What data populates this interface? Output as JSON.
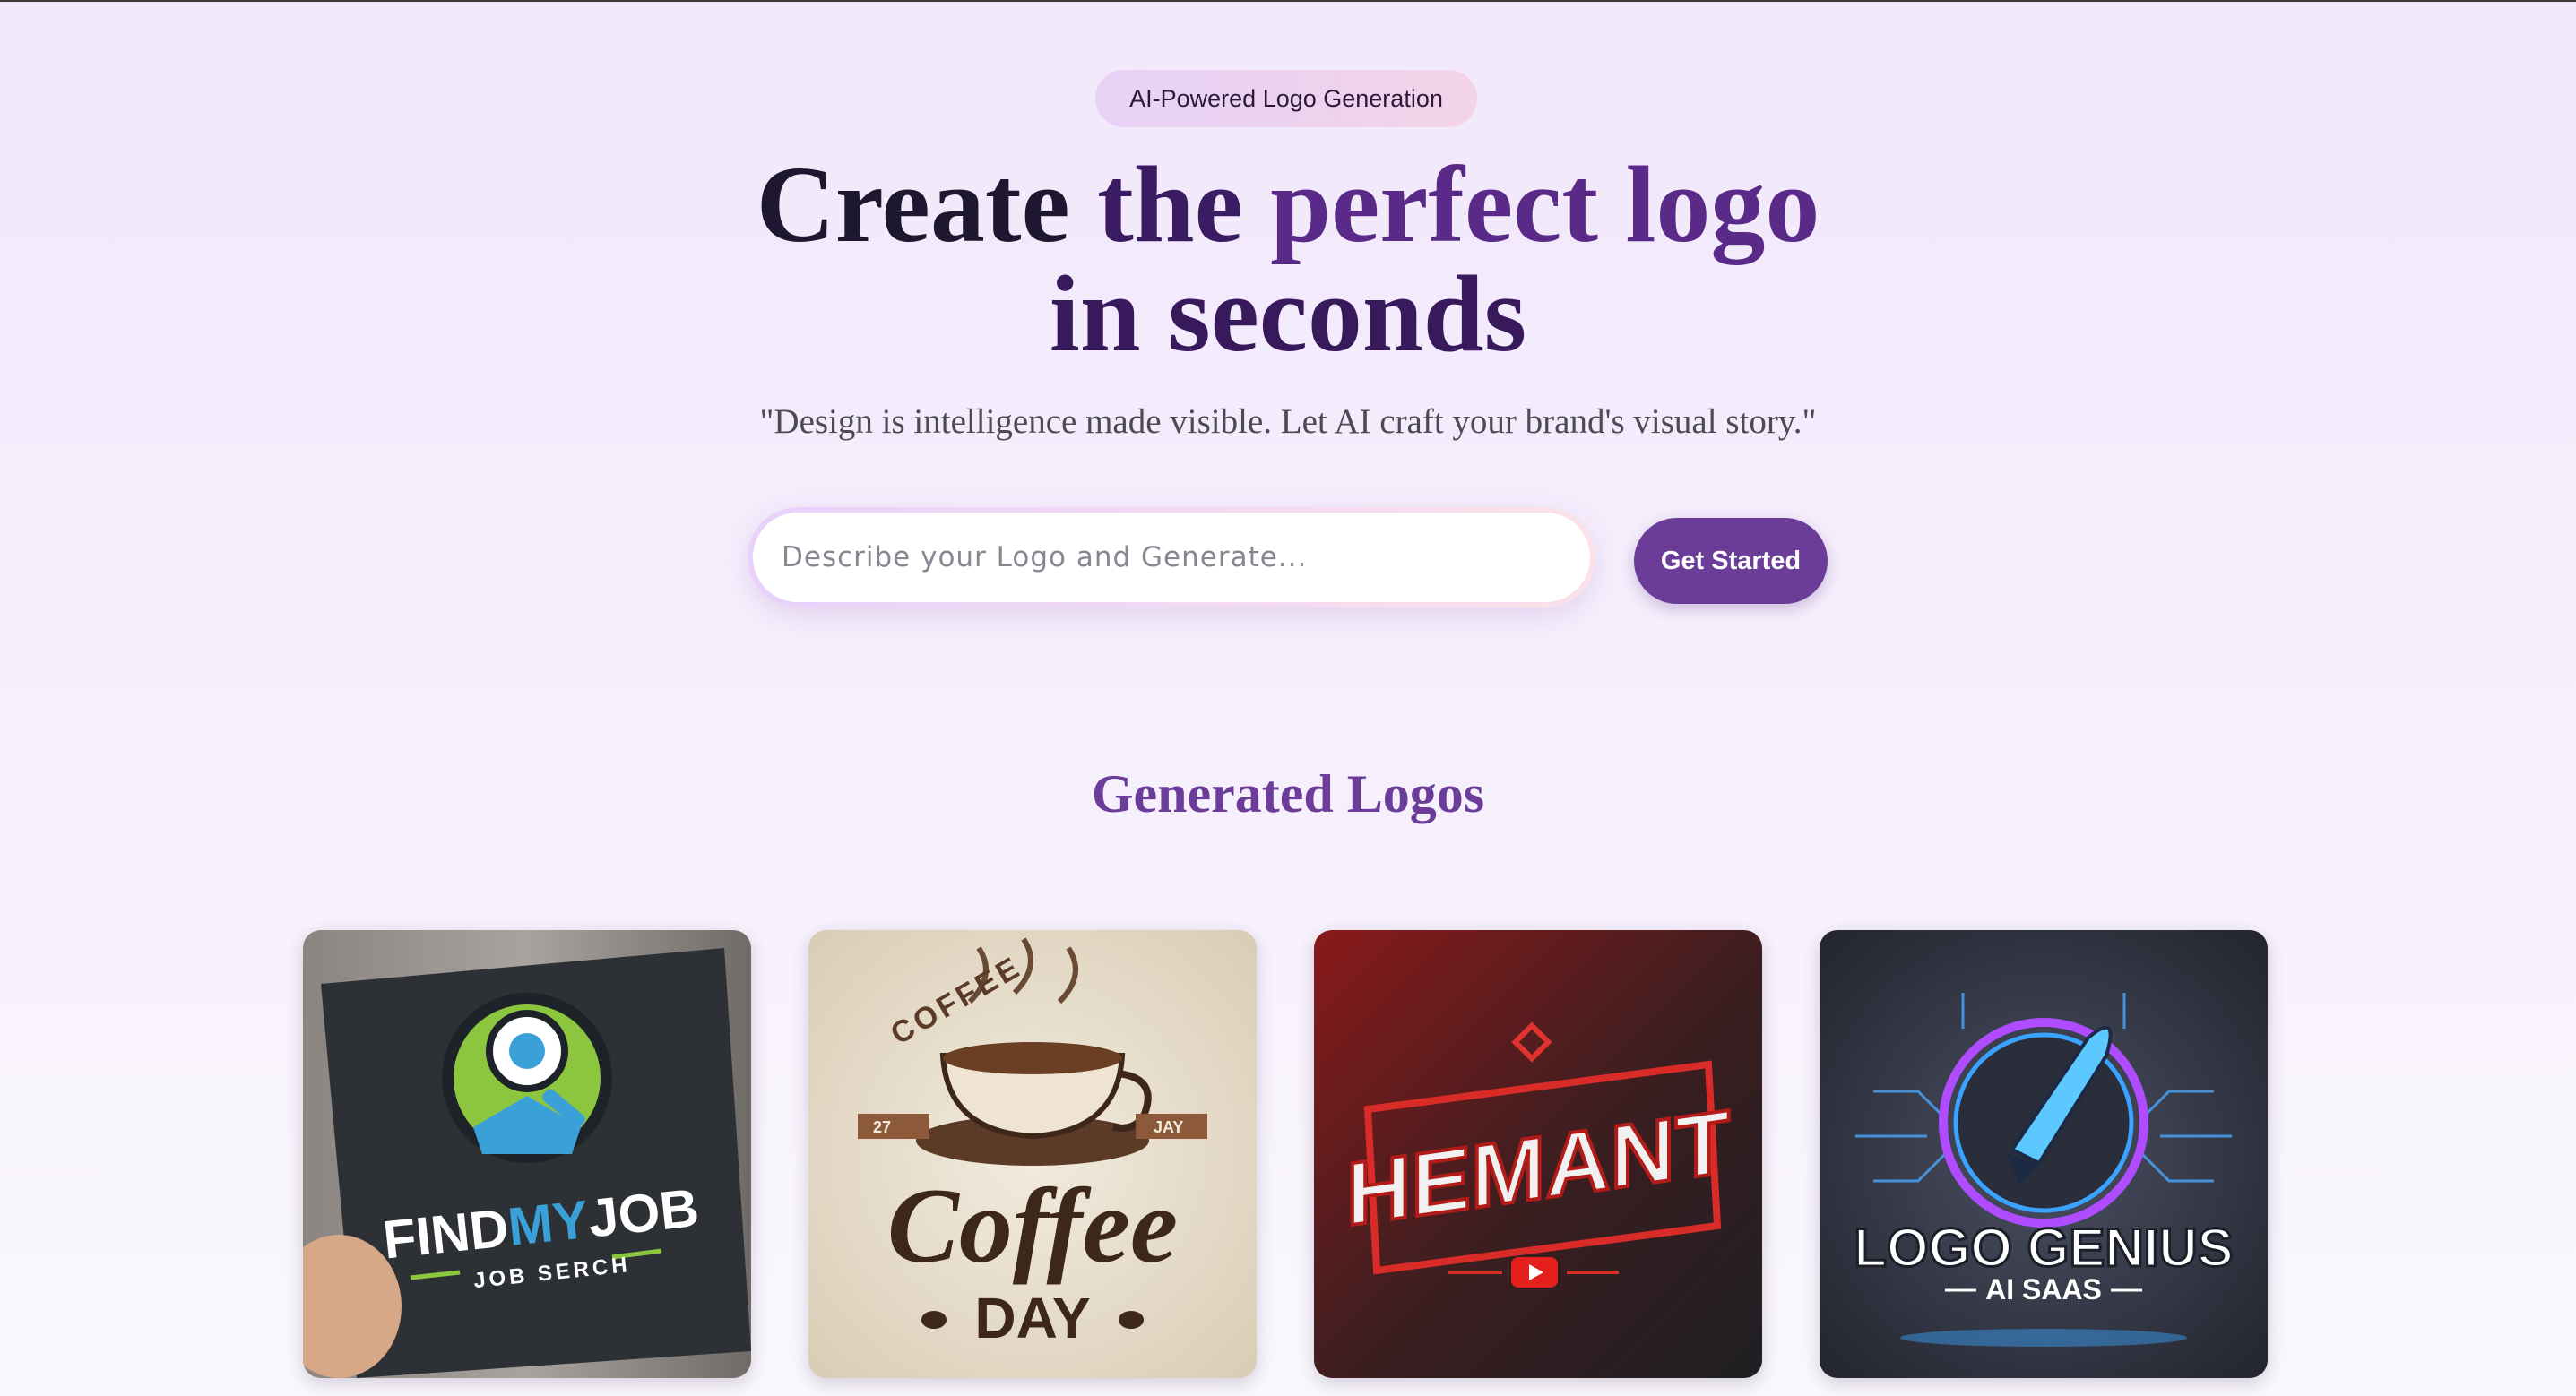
{
  "hero": {
    "badge": "AI-Powered Logo Generation",
    "headline_part1": "Create",
    "headline_part2": "the",
    "headline_part3": "perfect logo",
    "headline_line2": "in seconds",
    "quote": "\"Design is intelligence made visible. Let AI craft your brand's visual story.\""
  },
  "search": {
    "placeholder": "Describe your Logo and Generate...",
    "value": "",
    "button_label": "Get Started"
  },
  "gallery": {
    "title": "Generated Logos",
    "cards": [
      {
        "brand_a": "FIND",
        "brand_b": "MY",
        "brand_c": "JOB",
        "tagline": "JOB SERCH",
        "icon": "magnifier-person-icon"
      },
      {
        "top_text": "COFFEE",
        "brand": "Coffee",
        "sub": "DAY",
        "badge_left": "27",
        "badge_right": "JAY",
        "icon": "coffee-cup-icon"
      },
      {
        "brand": "HEMANT",
        "icon": "play-button-icon"
      },
      {
        "brand": "LOGO GENIUS",
        "tagline": "AI SAAS",
        "icon": "fountain-pen-icon"
      }
    ]
  },
  "colors": {
    "accent": "#6b3d98",
    "headline_dark": "#1e1730",
    "quote": "#4b4b55"
  }
}
